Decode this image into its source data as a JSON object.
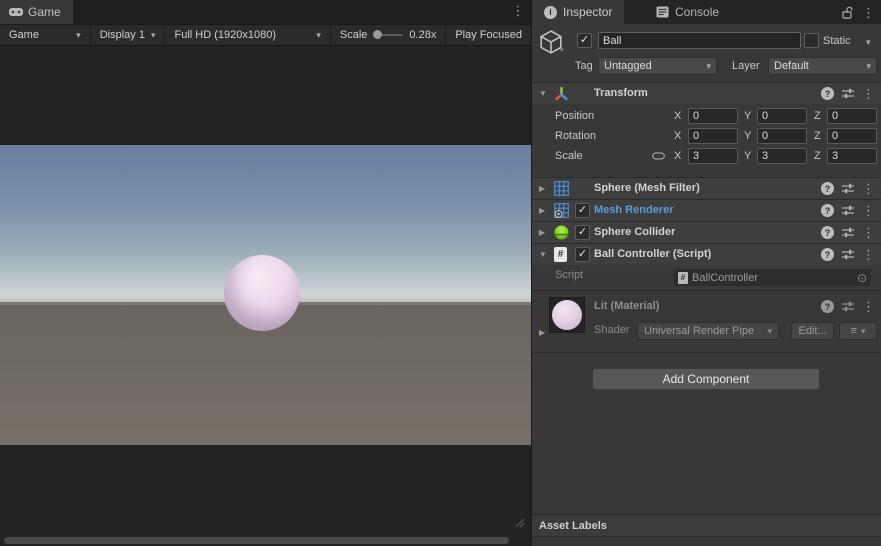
{
  "colors": {
    "accent_blue": "#5b9cd9",
    "mesh_icon_blue": "#4a90d9",
    "collider_green": "#8ce32a",
    "ball_pink": "#e8d4e6",
    "sky_top": "#67809f",
    "sky_horizon": "#d6dbd4",
    "ground_gray": "#6e6862",
    "panel_bg": "#383838",
    "header_bg": "#3e3e3e",
    "field_bg": "#272727"
  },
  "icons": {
    "check": "✓",
    "dropdown_arrow": "▾",
    "foldout_open": "▼",
    "foldout_closed": "▶",
    "kebab": "⋮",
    "object_picker": "⊙",
    "list_menu": "≡",
    "help": "?",
    "info": "i",
    "script_hash": "#"
  },
  "game_panel": {
    "tab_label": "Game",
    "toolbar": {
      "display_mode": "Game",
      "display": "Display 1",
      "resolution": "Full HD (1920x1080)",
      "scale_label": "Scale",
      "scale_value": "0.28x",
      "play_focused": "Play Focused"
    }
  },
  "inspector": {
    "tab_inspector": "Inspector",
    "tab_console": "Console",
    "gameobject": {
      "name": "Ball",
      "static_label": "Static",
      "tag_label": "Tag",
      "tag_value": "Untagged",
      "layer_label": "Layer",
      "layer_value": "Default"
    },
    "transform": {
      "title": "Transform",
      "axis": {
        "x": "X",
        "y": "Y",
        "z": "Z"
      },
      "rows": [
        {
          "label": "Position",
          "x": "0",
          "y": "0",
          "z": "0"
        },
        {
          "label": "Rotation",
          "x": "0",
          "y": "0",
          "z": "0"
        },
        {
          "label": "Scale",
          "x": "3",
          "y": "3",
          "z": "3"
        }
      ]
    },
    "components": [
      {
        "title": "Sphere (Mesh Filter)"
      },
      {
        "title": "Mesh Renderer"
      },
      {
        "title": "Sphere Collider"
      },
      {
        "title": "Ball Controller (Script)"
      }
    ],
    "script_row": {
      "label": "Script",
      "value": "BallController"
    },
    "material": {
      "title": "Lit (Material)",
      "shader_label": "Shader",
      "shader_value": "Universal Render Pipe",
      "edit_button": "Edit..."
    },
    "add_component_label": "Add Component",
    "asset_labels_label": "Asset Labels"
  }
}
